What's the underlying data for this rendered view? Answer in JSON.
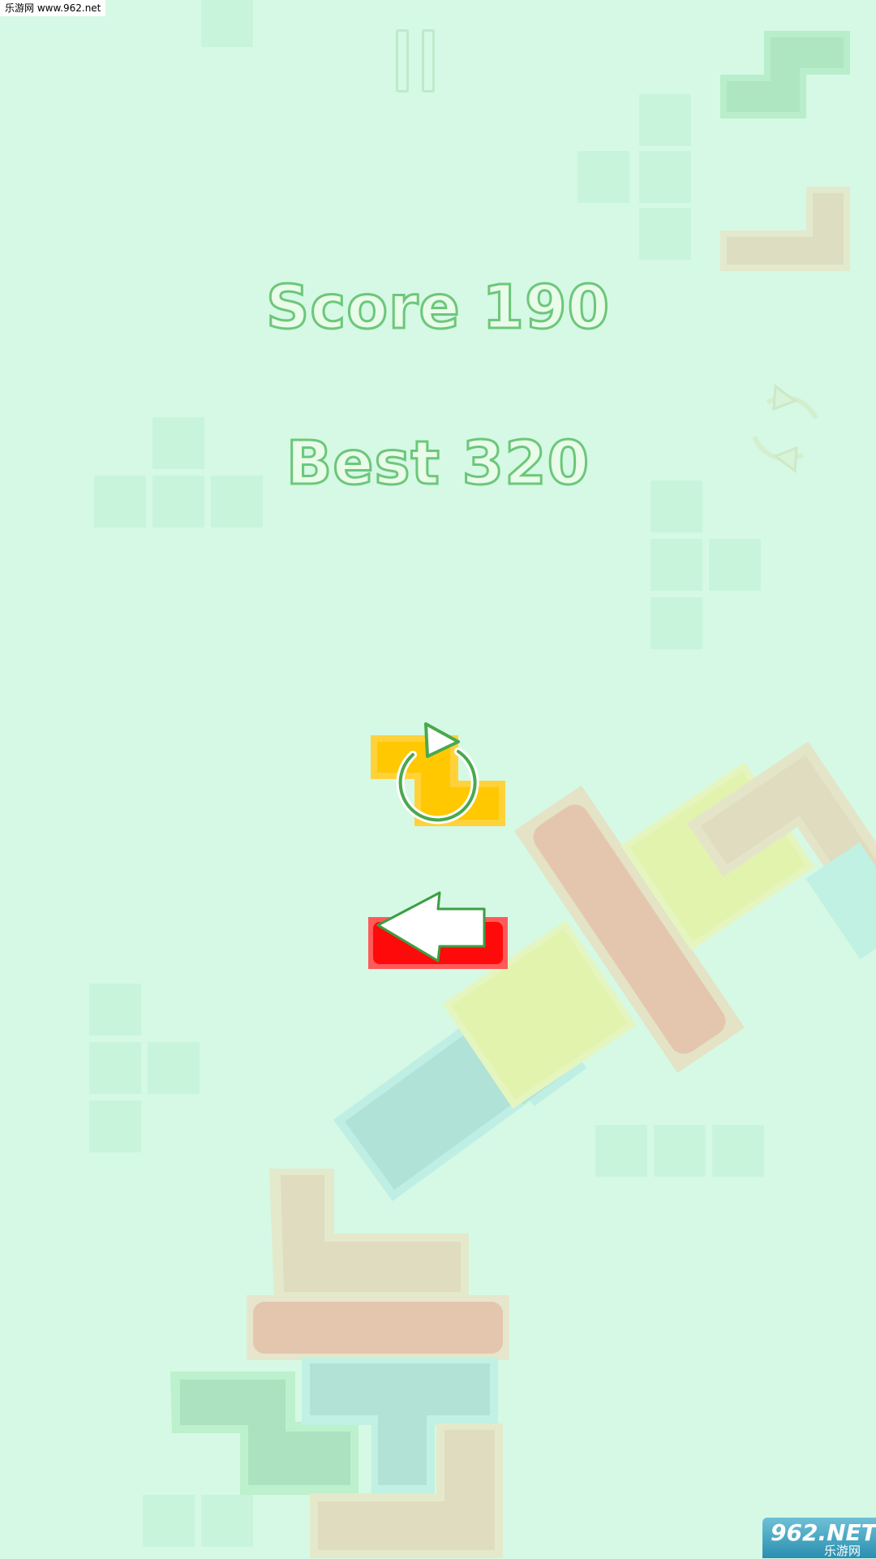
{
  "site_tag": "乐游网 www.962.net",
  "hud": {
    "score_text": "Score 190",
    "best_text": "Best 320"
  },
  "icons": {
    "pause": "pause-icon",
    "rotate": "rotate-icon",
    "restart": "restart-icon",
    "back": "back-arrow-icon"
  },
  "watermark": {
    "main": "962.NET",
    "sub": "乐游网"
  },
  "colors": {
    "background": "#d5f9e5",
    "text_fill": "#e9fbe9",
    "text_outline": "#6cc77a",
    "piece_yellow": "#ffcc00",
    "piece_red": "#ff1a1a"
  }
}
